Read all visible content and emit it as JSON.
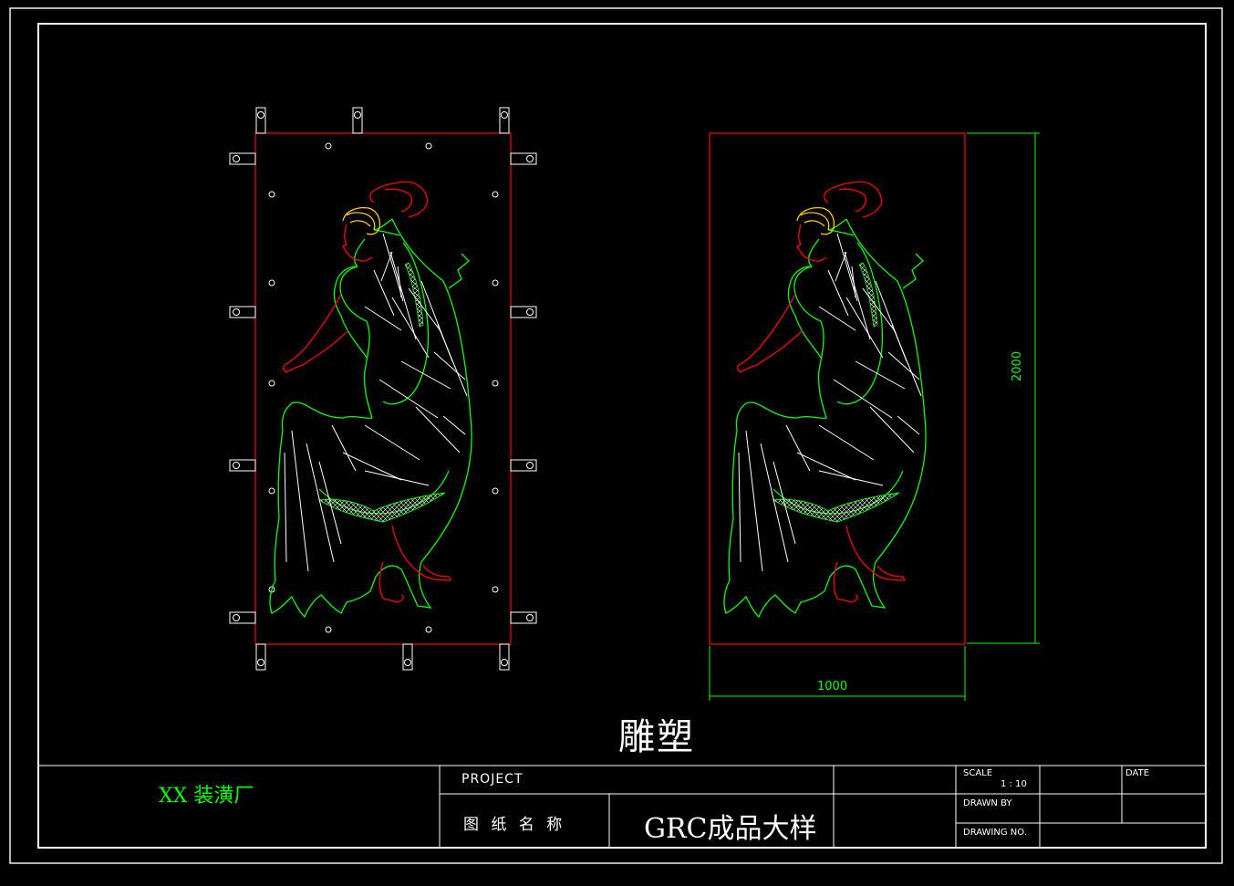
{
  "drawing": {
    "caption": "雕塑",
    "dimension_width": "1000",
    "dimension_height": "2000"
  },
  "title_block": {
    "company": "XX 装潢厂",
    "project_label": "PROJECT",
    "drawing_name_label": "图 纸 名 称",
    "drawing_name": "GRC成品大样",
    "scale_label": "SCALE",
    "scale_value": "1 : 10",
    "date_label": "DATE",
    "drawn_by_label": "DRAWN BY",
    "drawing_no_label": "DRAWING NO."
  },
  "colors": {
    "background": "#000000",
    "frame": "#ffffff",
    "panel_outline": "#ff0000",
    "dimension": "#00ff00",
    "figure_skin": "#ff0000",
    "figure_garment": "#00ff00",
    "figure_hair": "#ffcc00",
    "figure_folds": "#ffffff"
  }
}
